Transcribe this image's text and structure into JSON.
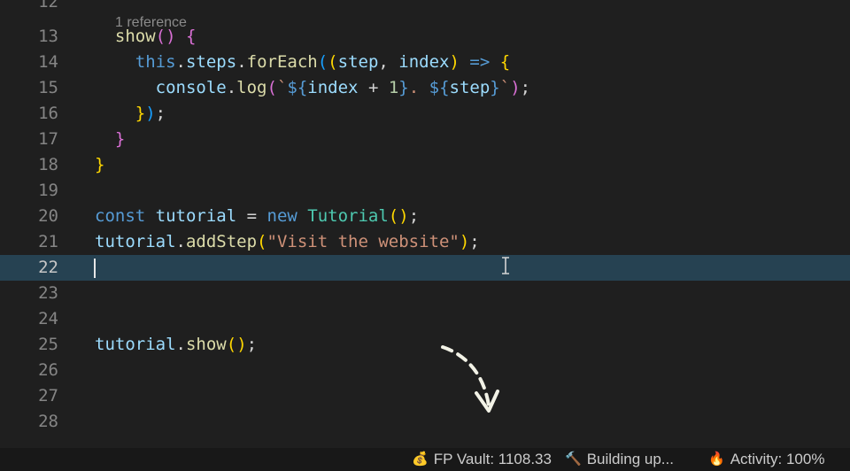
{
  "editor": {
    "codelens": "1 reference",
    "lines": [
      {
        "num": "12",
        "tokens": []
      },
      {
        "num": "13",
        "indent": "  ",
        "tokens": [
          {
            "t": "show",
            "c": "fn"
          },
          {
            "t": "(",
            "c": "p2"
          },
          {
            "t": ")",
            "c": "p2"
          },
          {
            "t": " ",
            "c": "plain"
          },
          {
            "t": "{",
            "c": "p2"
          }
        ]
      },
      {
        "num": "14",
        "indent": "    ",
        "tokens": [
          {
            "t": "this",
            "c": "kw"
          },
          {
            "t": ".",
            "c": "op"
          },
          {
            "t": "steps",
            "c": "var"
          },
          {
            "t": ".",
            "c": "op"
          },
          {
            "t": "forEach",
            "c": "fn"
          },
          {
            "t": "(",
            "c": "p3"
          },
          {
            "t": "(",
            "c": "p1"
          },
          {
            "t": "step",
            "c": "var"
          },
          {
            "t": ", ",
            "c": "op"
          },
          {
            "t": "index",
            "c": "var"
          },
          {
            "t": ")",
            "c": "p1"
          },
          {
            "t": " ",
            "c": "plain"
          },
          {
            "t": "=>",
            "c": "kw"
          },
          {
            "t": " ",
            "c": "plain"
          },
          {
            "t": "{",
            "c": "p1"
          }
        ]
      },
      {
        "num": "15",
        "indent": "      ",
        "tokens": [
          {
            "t": "console",
            "c": "var"
          },
          {
            "t": ".",
            "c": "op"
          },
          {
            "t": "log",
            "c": "fn"
          },
          {
            "t": "(",
            "c": "p2"
          },
          {
            "t": "`",
            "c": "str"
          },
          {
            "t": "${",
            "c": "tpl"
          },
          {
            "t": "index",
            "c": "var"
          },
          {
            "t": " + ",
            "c": "op"
          },
          {
            "t": "1",
            "c": "num"
          },
          {
            "t": "}",
            "c": "tpl"
          },
          {
            "t": ". ",
            "c": "str"
          },
          {
            "t": "${",
            "c": "tpl"
          },
          {
            "t": "step",
            "c": "var"
          },
          {
            "t": "}",
            "c": "tpl"
          },
          {
            "t": "`",
            "c": "str"
          },
          {
            "t": ")",
            "c": "p2"
          },
          {
            "t": ";",
            "c": "op"
          }
        ]
      },
      {
        "num": "16",
        "indent": "    ",
        "tokens": [
          {
            "t": "}",
            "c": "p1"
          },
          {
            "t": ")",
            "c": "p3"
          },
          {
            "t": ";",
            "c": "op"
          }
        ]
      },
      {
        "num": "17",
        "indent": "  ",
        "tokens": [
          {
            "t": "}",
            "c": "p2"
          }
        ]
      },
      {
        "num": "18",
        "indent": "",
        "tokens": [
          {
            "t": "}",
            "c": "p1"
          }
        ]
      },
      {
        "num": "19",
        "tokens": []
      },
      {
        "num": "20",
        "indent": "",
        "tokens": [
          {
            "t": "const",
            "c": "kw"
          },
          {
            "t": " ",
            "c": "plain"
          },
          {
            "t": "tutorial",
            "c": "var"
          },
          {
            "t": " = ",
            "c": "op"
          },
          {
            "t": "new",
            "c": "kw"
          },
          {
            "t": " ",
            "c": "plain"
          },
          {
            "t": "Tutorial",
            "c": "cls"
          },
          {
            "t": "(",
            "c": "p1"
          },
          {
            "t": ")",
            "c": "p1"
          },
          {
            "t": ";",
            "c": "op"
          }
        ]
      },
      {
        "num": "21",
        "indent": "",
        "tokens": [
          {
            "t": "tutorial",
            "c": "var"
          },
          {
            "t": ".",
            "c": "op"
          },
          {
            "t": "addStep",
            "c": "fn"
          },
          {
            "t": "(",
            "c": "p1"
          },
          {
            "t": "\"Visit the website\"",
            "c": "str"
          },
          {
            "t": ")",
            "c": "p1"
          },
          {
            "t": ";",
            "c": "op"
          }
        ]
      },
      {
        "num": "22",
        "active": true,
        "tokens": []
      },
      {
        "num": "23",
        "tokens": []
      },
      {
        "num": "24",
        "tokens": []
      },
      {
        "num": "25",
        "indent": "",
        "tokens": [
          {
            "t": "tutorial",
            "c": "var"
          },
          {
            "t": ".",
            "c": "op"
          },
          {
            "t": "show",
            "c": "fn"
          },
          {
            "t": "(",
            "c": "p1"
          },
          {
            "t": ")",
            "c": "p1"
          },
          {
            "t": ";",
            "c": "op"
          }
        ]
      },
      {
        "num": "26",
        "tokens": []
      },
      {
        "num": "27",
        "tokens": []
      },
      {
        "num": "28",
        "tokens": []
      }
    ]
  },
  "statusbar": {
    "vault": {
      "icon": "money-bag-icon",
      "glyph": "💰",
      "label": "FP Vault: 1108.33"
    },
    "build": {
      "icon": "hammer-icon",
      "glyph": "🔨",
      "label": "Building up..."
    },
    "activity": {
      "icon": "fire-icon",
      "glyph": "🔥",
      "label": "Activity: 100%"
    }
  },
  "colors": {
    "editor_bg": "#1f1f1f",
    "active_line": "#264252",
    "statusbar_bg": "#181818"
  }
}
